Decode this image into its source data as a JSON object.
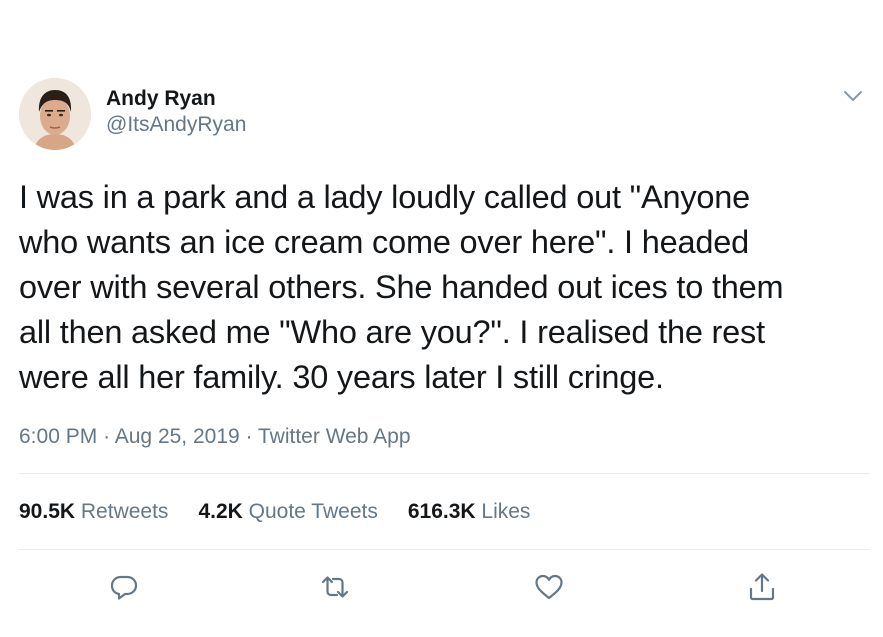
{
  "tweet": {
    "author": {
      "display_name": "Andy Ryan",
      "handle": "@ItsAndyRyan"
    },
    "text_lines": [
      "I was in a park and a lady loudly called out \"Anyone",
      "who wants an ice cream come over here\". I headed",
      "over with several others. She handed out ices to them",
      "all then asked me \"Who are you?\". I realised the rest",
      "were all her family. 30 years later I still cringe."
    ],
    "time": "6:00 PM",
    "separator": "·",
    "date": "Aug 25, 2019",
    "source": "Twitter Web App",
    "stats": {
      "retweets_count": "90.5K",
      "retweets_label": "Retweets",
      "quotes_count": "4.2K",
      "quotes_label": "Quote Tweets",
      "likes_count": "616.3K",
      "likes_label": "Likes"
    },
    "icons": {
      "menu": "chevron-down-icon",
      "reply": "reply-icon",
      "retweet": "retweet-icon",
      "like": "heart-icon",
      "share": "share-icon"
    },
    "colors": {
      "text": "#14171a",
      "secondary": "#657786",
      "divider": "#e6ecf0"
    }
  }
}
